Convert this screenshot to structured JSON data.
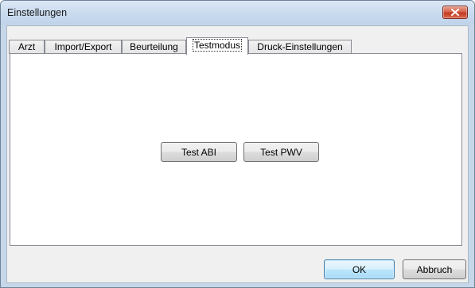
{
  "window": {
    "title": "Einstellungen",
    "close_icon": "close-x-icon"
  },
  "tabs": [
    {
      "label": "Arzt",
      "active": false
    },
    {
      "label": "Import/Export",
      "active": false
    },
    {
      "label": "Beurteilung",
      "active": false
    },
    {
      "label": "Testmodus",
      "active": true
    },
    {
      "label": "Druck-Einstellungen",
      "active": false
    }
  ],
  "panel": {
    "test_abi_label": "Test ABI",
    "test_pwv_label": "Test PWV"
  },
  "footer": {
    "ok_label": "OK",
    "cancel_label": "Abbruch"
  },
  "colors": {
    "title_bar": "#c9dbee",
    "close_button": "#c23b22",
    "dialog_bg": "#f0f0f0",
    "default_button_border": "#3c7fb1"
  }
}
